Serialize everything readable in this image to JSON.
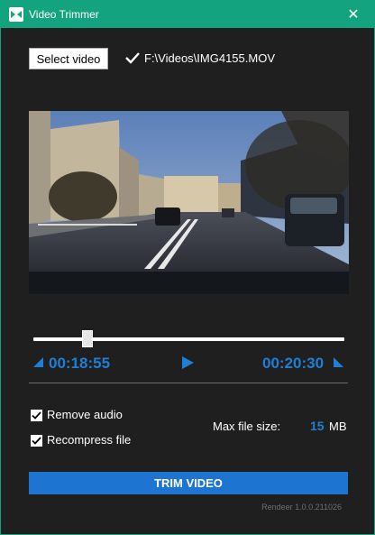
{
  "window": {
    "title": "Video Trimmer",
    "close_glyph": "✕"
  },
  "toolbar": {
    "select_label": "Select video",
    "file_path": "F:\\Videos\\IMG4155.MOV",
    "status_icon": "check-icon"
  },
  "trim": {
    "start_time": "00:18:55",
    "end_time": "00:20:30",
    "start_fraction": 0.18
  },
  "options": {
    "remove_audio": {
      "label": "Remove audio",
      "checked": true
    },
    "recompress": {
      "label": "Recompress file",
      "checked": true
    }
  },
  "max_size": {
    "label": "Max file size:",
    "value": "15",
    "unit": "MB"
  },
  "action": {
    "trim_label": "TRIM VIDEO"
  },
  "footer": {
    "version": "Rendeer 1.0.0.211026"
  },
  "colors": {
    "accent": "#14a37f",
    "blue": "#1e7fd6",
    "background": "#1f1f1f"
  }
}
